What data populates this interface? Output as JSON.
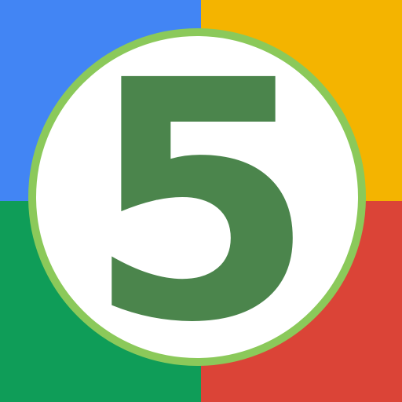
{
  "logo": {
    "digit": "5",
    "colors": {
      "top_left": "#4285f4",
      "top_right": "#f4b400",
      "bottom_left": "#0f9d58",
      "bottom_right": "#db4437",
      "ring": "#8bc95a",
      "badge_fill": "#ffffff",
      "digit": "#4b854c"
    }
  }
}
